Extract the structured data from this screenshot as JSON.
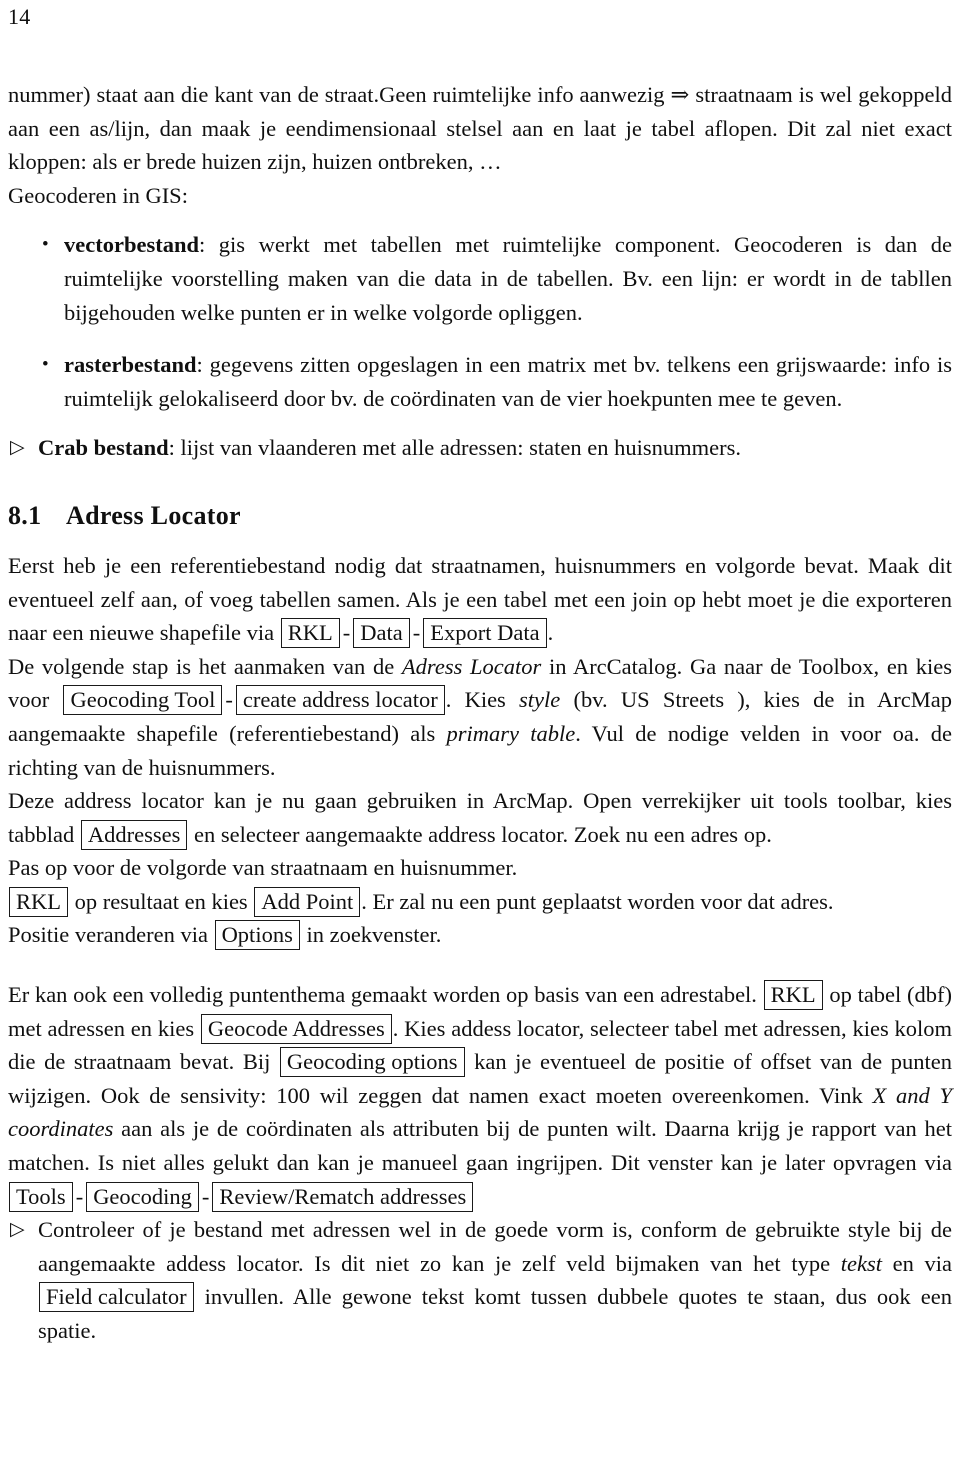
{
  "page": {
    "number": "14"
  },
  "intro": {
    "para1_a": "nummer) staat aan die kant van de straat.Geen ruimtelijke info aanwezig ",
    "arrow": "⇒",
    "para1_b": " straatnaam is wel gekoppeld aan een as/lijn, dan maak je eendimensionaal stelsel aan en laat je tabel aflopen. Dit zal niet exact kloppen: als er brede huizen zijn, huizen ontbreken, ",
    "ellipsis": "…",
    "lead": "Geocoderen in GIS:"
  },
  "items": [
    {
      "bullet": "•",
      "term": "vectorbestand",
      "colon": ":",
      "text": " gis werkt met tabellen met ruimtelijke component. Geocoderen is dan de ruimtelijke voorstelling maken van die data in de tabellen. Bv. een lijn: er wordt in de tabllen bijgehouden welke punten er in welke volgorde opliggen."
    },
    {
      "bullet": "•",
      "term": "rasterbestand",
      "colon": ":",
      "text": " gegevens zitten opgeslagen in een matrix met bv. telkens een grijswaarde: info is ruimtelijk gelokaliseerd door bv. de coördinaten van de vier hoekpunten mee te geven."
    }
  ],
  "crab": {
    "marker": "▷",
    "term": "Crab bestand",
    "colon": ":",
    "text": " lijst van vlaanderen met alle adressen: staten en huisnummers."
  },
  "section": {
    "number": "8.1",
    "title": "Adress Locator"
  },
  "s1": {
    "t1": "Eerst heb je een referentiebestand nodig dat straatnamen, huisnummers en volgorde bevat. Maak dit eventueel zelf aan, of voeg tabellen samen. Als je een tabel met een join op hebt moet je die exporteren naar een nieuwe shapefile via ",
    "box_rkl": "RKL",
    "dash1": "-",
    "box_data": "Data",
    "dash2": "-",
    "box_export_data": "Export Data",
    "t2": "."
  },
  "s2": {
    "t1": "De volgende stap is het aanmaken van de ",
    "it1": "Adress Locator",
    "t2": " in ArcCatalog. Ga naar de Toolbox, en kies voor ",
    "box_geocoding_tool": "Geocoding Tool",
    "dash1": "-",
    "box_create_address_locator": "create address locator",
    "t3": ". Kies ",
    "it2": "style",
    "t4": " (bv. US Streets ), kies de in ArcMap aangemaakte shapefile (referentiebestand) als ",
    "it3": "primary table",
    "t5": ". Vul de nodige velden in voor oa. de richting van de huisnummers."
  },
  "s3": {
    "t1": "Deze address locator kan je nu gaan gebruiken in ArcMap. Open verrekijker uit tools toolbar, kies tabblad ",
    "box_addresses": "Addresses",
    "t2": " en selecteer aangemaakte address locator. Zoek nu een adres op."
  },
  "s4": {
    "t1": "Pas op voor de volgorde van straatnaam en huisnummer."
  },
  "s5": {
    "box_rkl": "RKL",
    "t1": " op resultaat en kies ",
    "box_add_point": "Add Point",
    "t2": ". Er zal nu een punt geplaatst worden voor dat adres."
  },
  "s6": {
    "t1": "Positie veranderen via ",
    "box_options": "Options",
    "t2": " in zoekvenster."
  },
  "s7": {
    "t1": "Er kan ook een volledig puntenthema gemaakt worden op basis van een adrestabel. ",
    "box_rkl": "RKL",
    "t2": " op tabel (dbf) met adressen en kies ",
    "box_geocode_addresses": "Geocode Addresses",
    "t3": ". Kies addess locator, selecteer tabel met adressen, kies kolom die de straatnaam bevat. Bij ",
    "box_geocoding_options": "Geocoding options",
    "t4": " kan je eventueel de positie of offset van de punten wijzigen. Ook de sensivity: 100 wil zeggen dat namen exact moeten overeenkomen. Vink ",
    "it1": "X and Y coordinates",
    "t5": " aan als je de coördinaten als attributen bij de punten wilt. Daarna krijg je rapport van het matchen. Is niet alles gelukt dan kan je manueel gaan ingrijpen. Dit venster kan je later opvragen via ",
    "box_tools": "Tools",
    "dash1": "-",
    "box_geocoding": "Geocoding",
    "dash2": "-",
    "box_review_rematch": "Review/Rematch addresses"
  },
  "s8": {
    "marker": "▷",
    "t1": "Controleer of je bestand met adressen wel in de goede vorm is, conform de gebruikte style bij de aangemaakte addess locator. Is dit niet zo kan je zelf veld bijmaken van het type ",
    "it1": "tekst",
    "t2": " en via ",
    "box_field_calculator": "Field calculator",
    "t3": " invullen. Alle gewone tekst komt tussen dubbele quotes te staan, dus ook een spatie."
  }
}
